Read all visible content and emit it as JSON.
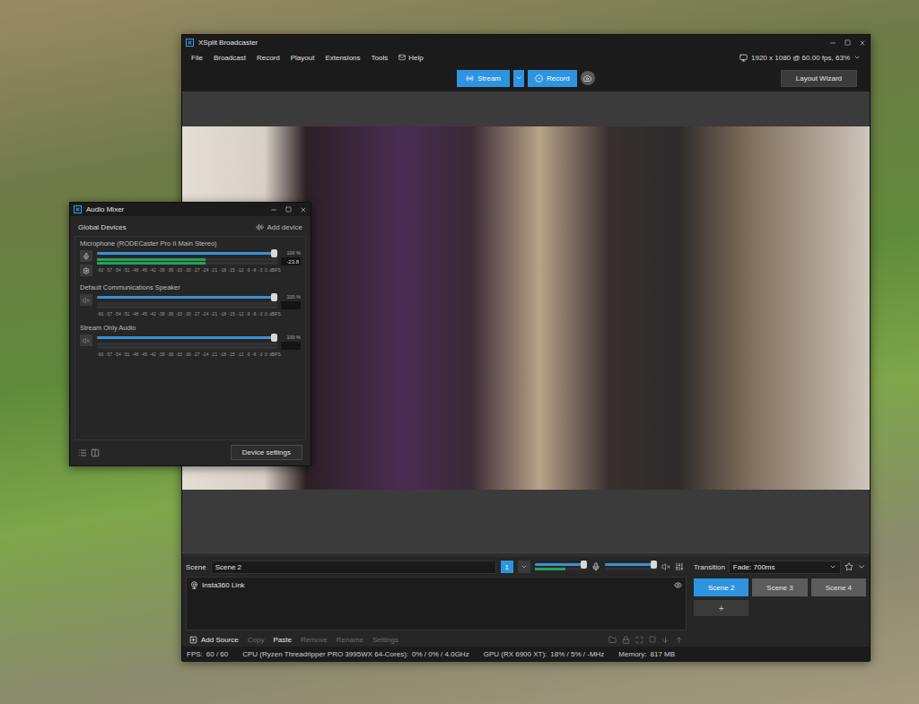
{
  "window": {
    "title": "XSplit Broadcaster"
  },
  "menu": [
    {
      "label": "File",
      "kind": "text"
    },
    {
      "label": "Broadcast",
      "kind": "text"
    },
    {
      "label": "Record",
      "kind": "text"
    },
    {
      "label": "Playout",
      "kind": "text"
    },
    {
      "label": "Extensions",
      "kind": "text"
    },
    {
      "label": "Tools",
      "kind": "text"
    },
    {
      "label": "Help",
      "kind": "mail"
    }
  ],
  "resolution": "1920 x 1080 @ 60.00 fps, 63%",
  "toolbar": {
    "stream": "Stream",
    "record": "Record",
    "layout_wizard": "Layout Wizard"
  },
  "scene_bar": {
    "label": "Scene",
    "name": "Scene 2",
    "badge": "1",
    "audio": [
      {
        "kind": "mic",
        "level": 1,
        "meter": 0.6,
        "muted": false
      },
      {
        "kind": "speaker",
        "level": 1,
        "meter": 0,
        "muted": true
      }
    ]
  },
  "transition": {
    "label": "Transition",
    "value": "Fade: 700ms"
  },
  "sources": [
    {
      "name": "Insta360 Link",
      "visible": true
    }
  ],
  "source_actions": [
    {
      "label": "Add Source",
      "disabled": false
    },
    {
      "label": "Copy",
      "disabled": true
    },
    {
      "label": "Paste",
      "disabled": false
    },
    {
      "label": "Remove",
      "disabled": true
    },
    {
      "label": "Rename",
      "disabled": true
    },
    {
      "label": "Settings",
      "disabled": true
    }
  ],
  "scenes": [
    {
      "label": "Scene 2",
      "selected": true
    },
    {
      "label": "Scene 3",
      "selected": false
    },
    {
      "label": "Scene 4",
      "selected": false
    }
  ],
  "add_scene": "+",
  "status_bar": [
    {
      "label": "FPS:",
      "value": "60 / 60"
    },
    {
      "label": "CPU (Ryzen Threadripper PRO 3995WX 64-Cores):",
      "value": "0% / 0% / 4.0GHz"
    },
    {
      "label": "GPU (RX 6900 XT):",
      "value": "18% / 5% / -MHz"
    },
    {
      "label": "Memory:",
      "value": "817 MB"
    }
  ],
  "audio_mixer": {
    "title": "Audio Mixer",
    "section": "Global Devices",
    "add_device": "Add device",
    "channels": [
      {
        "name": "Microphone (RODECaster Pro II Main Stereo)",
        "kind": "microphone",
        "muted": false,
        "volume": 1,
        "volume_label": "100 %",
        "meter": 0.6,
        "reading": "-23.8"
      },
      {
        "name": "Default Communications Speaker",
        "kind": "speaker",
        "muted": true,
        "volume": 1,
        "volume_label": "100 %",
        "meter": 0,
        "reading": ""
      },
      {
        "name": "Stream Only Audio",
        "kind": "speaker",
        "muted": true,
        "volume": 1,
        "volume_label": "100 %",
        "meter": 0,
        "reading": ""
      }
    ],
    "scale": [
      "-60",
      "-57",
      "-54",
      "-51",
      "-48",
      "-45",
      "-42",
      "-39",
      "-36",
      "-33",
      "-30",
      "-27",
      "-24",
      "-21",
      "-18",
      "-15",
      "-12",
      "-9",
      "-6",
      "-3",
      "0",
      "dBFS"
    ],
    "device_settings": "Device settings"
  }
}
